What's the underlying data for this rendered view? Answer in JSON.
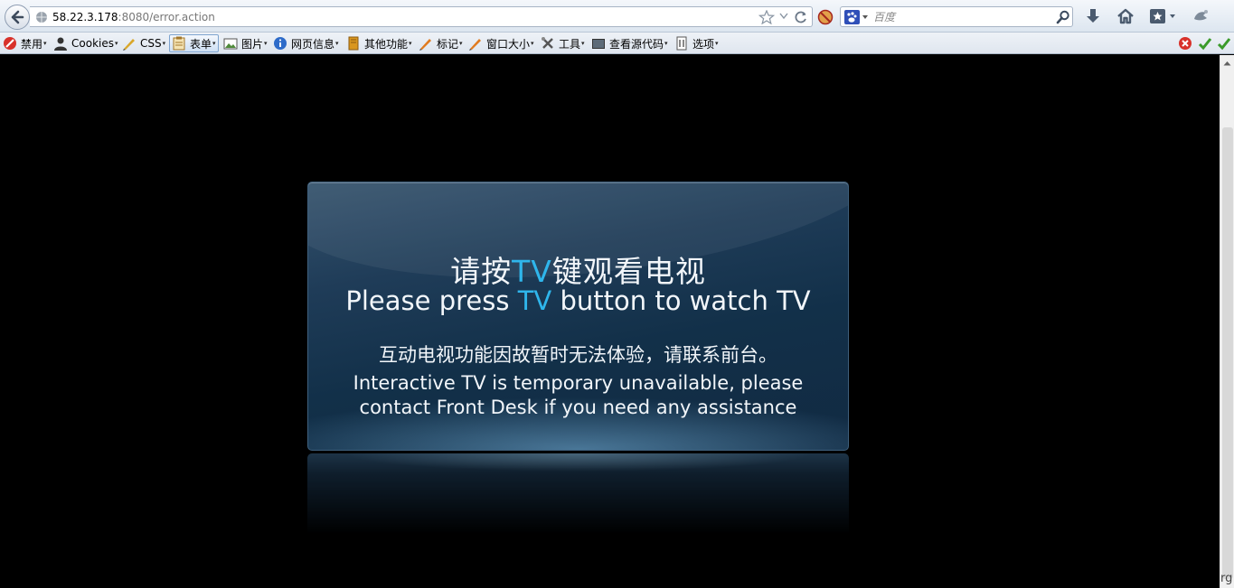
{
  "navbar": {
    "url_host": "58.22.3.178",
    "url_rest": ":8080/error.action",
    "search_placeholder": "百度"
  },
  "toolbar": {
    "items": [
      {
        "label": "禁用",
        "icon": "disable-icon"
      },
      {
        "label": "Cookies",
        "icon": "cookies-icon"
      },
      {
        "label": "CSS",
        "icon": "css-icon"
      },
      {
        "label": "表单",
        "icon": "forms-icon"
      },
      {
        "label": "图片",
        "icon": "images-icon"
      },
      {
        "label": "网页信息",
        "icon": "info-icon"
      },
      {
        "label": "其他功能",
        "icon": "misc-icon"
      },
      {
        "label": "标记",
        "icon": "outline-icon"
      },
      {
        "label": "窗口大小",
        "icon": "resize-icon"
      },
      {
        "label": "工具",
        "icon": "tools-icon"
      },
      {
        "label": "查看源代码",
        "icon": "view-source-icon"
      },
      {
        "label": "选项",
        "icon": "options-icon"
      }
    ]
  },
  "panel": {
    "title_cn_before": "请按",
    "title_cn_tv": "TV",
    "title_cn_after": "键观看电视",
    "title_en_before": "Please press ",
    "title_en_tv": "TV",
    "title_en_after": " button to watch TV",
    "notice_cn": "互动电视功能因故暂时无法体验，请联系前台。",
    "notice_en_line1": "Interactive TV is temporary unavailable, please",
    "notice_en_line2": "contact Front Desk if you need any assistance"
  },
  "colors": {
    "tv_accent": "#2fb6ec",
    "panel_base": "#1f3c58"
  },
  "corner_text": "rg"
}
